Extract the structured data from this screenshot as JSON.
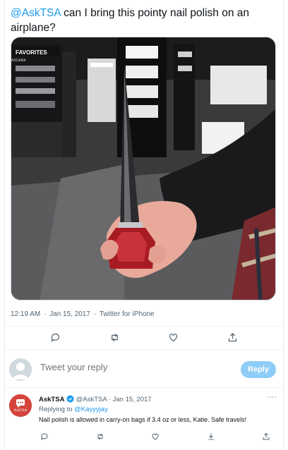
{
  "tweet": {
    "mention": "@AskTSA",
    "text": " can I bring this pointy nail polish on an airplane?",
    "media_description_labels": {
      "store_sign": "FAVORITES",
      "store_sign_sub": "ASCARA"
    },
    "time": "12:19 AM",
    "dot1": " · ",
    "date": "Jan 15, 2017",
    "dot2": " · ",
    "source": "Twitter for iPhone",
    "actions": [
      {
        "icon": "reply-icon"
      },
      {
        "icon": "retweet-icon"
      },
      {
        "icon": "like-icon"
      },
      {
        "icon": "share-icon"
      }
    ]
  },
  "reply_box": {
    "placeholder": "Tweet your reply",
    "button_label": "Reply"
  },
  "reply_tweet": {
    "name": "AskTSA",
    "handle": "@AskTSA",
    "dot": " · ",
    "date": "Jan 15, 2017",
    "more": "···",
    "replying_prefix": "Replying to ",
    "replying_to": "@Kayyyjay",
    "body": "Nail polish is allowed in carry-on bags if 3.4 oz or less, Katie. Safe travels!",
    "avatar_text": "AskTSA",
    "colors": {
      "avatar_bg": "#d4443b",
      "verified": "#1d9bf0"
    }
  },
  "colors": {
    "accent": "#1d9bf0",
    "reply_button_bg": "#8ecdf7",
    "muted_text": "#536471"
  }
}
